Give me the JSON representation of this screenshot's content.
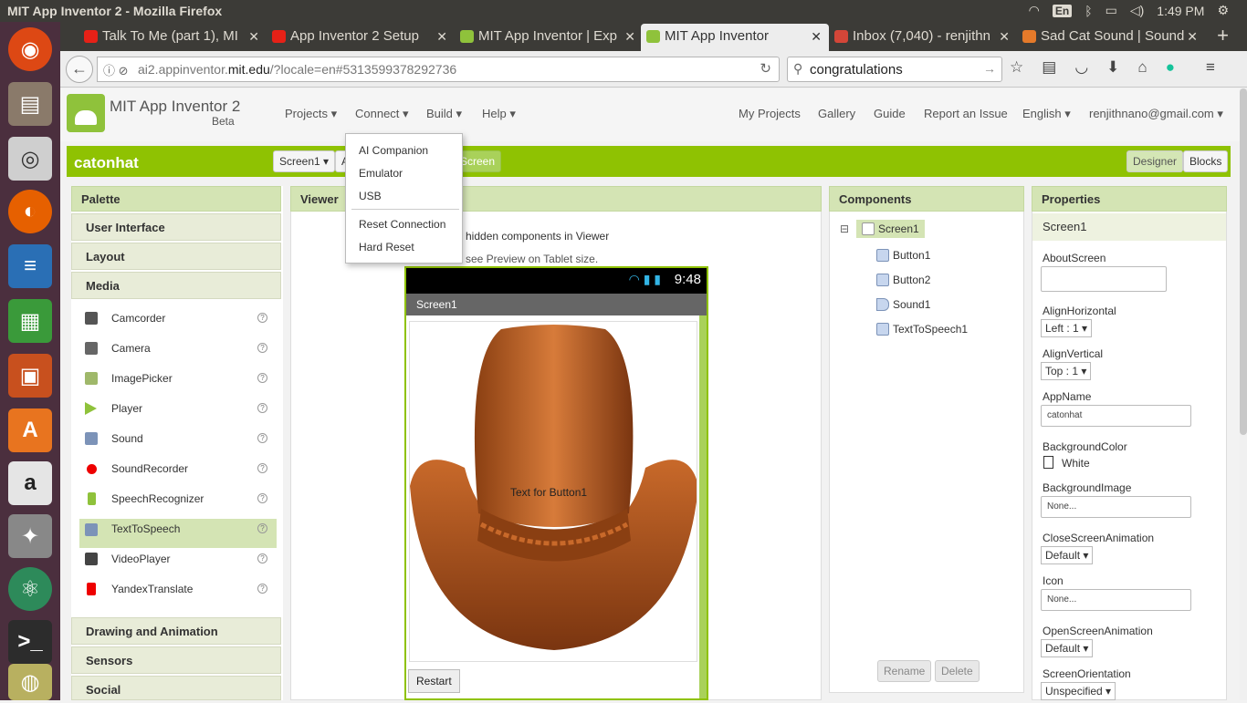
{
  "os": {
    "window_title": "MIT App Inventor 2 - Mozilla Firefox",
    "keyboard": "En",
    "time": "1:49 PM"
  },
  "tabs": [
    {
      "label": "Talk To Me (part 1), MI",
      "color": "#e62117"
    },
    {
      "label": "App Inventor 2 Setup",
      "color": "#e62117"
    },
    {
      "label": "MIT App Inventor | Exp",
      "color": "#8fc23b"
    },
    {
      "label": "MIT App Inventor",
      "color": "#8fc23b"
    },
    {
      "label": "Inbox (7,040) - renjithn",
      "color": "#d44638"
    },
    {
      "label": "Sad Cat Sound | Sound",
      "color": "#e57a2a"
    }
  ],
  "nav": {
    "url_prefix": "ai2.appinventor.",
    "url_domain": "mit.edu",
    "url_suffix": "/?locale=en#5313599378292736",
    "search_value": "congratulations"
  },
  "app": {
    "title": "MIT App Inventor 2",
    "beta": "Beta",
    "menus": {
      "projects": "Projects ▾",
      "connect": "Connect ▾",
      "build": "Build ▾",
      "help": "Help ▾"
    },
    "right_links": {
      "my_projects": "My Projects",
      "gallery": "Gallery",
      "guide": "Guide",
      "report": "Report an Issue",
      "language": "English ▾",
      "account": "renjithnano@gmail.com ▾"
    },
    "accent": "#8fc202"
  },
  "project": {
    "name": "catonhat",
    "screen_select": "Screen1 ▾",
    "add_screen_partial": "A",
    "remove_screen_partial": "Screen",
    "designer": "Designer",
    "blocks": "Blocks"
  },
  "connect_menu": {
    "ai_companion": "AI Companion",
    "emulator": "Emulator",
    "usb": "USB",
    "reset_connection": "Reset Connection",
    "hard_reset": "Hard Reset"
  },
  "palette": {
    "header": "Palette",
    "categories_top": [
      "User Interface",
      "Layout",
      "Media"
    ],
    "items": [
      {
        "label": "Camcorder",
        "icon": "camcorder-icon"
      },
      {
        "label": "Camera",
        "icon": "camera-icon"
      },
      {
        "label": "ImagePicker",
        "icon": "image-picker-icon"
      },
      {
        "label": "Player",
        "icon": "player-icon"
      },
      {
        "label": "Sound",
        "icon": "sound-icon"
      },
      {
        "label": "SoundRecorder",
        "icon": "sound-recorder-icon"
      },
      {
        "label": "SpeechRecognizer",
        "icon": "speech-recognizer-icon"
      },
      {
        "label": "TextToSpeech",
        "icon": "text-to-speech-icon"
      },
      {
        "label": "VideoPlayer",
        "icon": "video-player-icon"
      },
      {
        "label": "YandexTranslate",
        "icon": "yandex-translate-icon"
      }
    ],
    "help_glyph": "?",
    "categories_bottom": [
      "Drawing and Animation",
      "Sensors",
      "Social"
    ]
  },
  "viewer": {
    "header": "Viewer",
    "hidden_text": "hidden components in Viewer",
    "preview_text": "see Preview on Tablet size.",
    "phone_time": "9:48",
    "screen_title": "Screen1",
    "button1_text": "Text for Button1",
    "restart": "Restart"
  },
  "components": {
    "header": "Components",
    "collapse": "⊟",
    "root": "Screen1",
    "children": [
      "Button1",
      "Button2",
      "Sound1",
      "TextToSpeech1"
    ],
    "rename": "Rename",
    "delete": "Delete"
  },
  "properties": {
    "header": "Properties",
    "component": "Screen1",
    "about_screen_label": "AboutScreen",
    "align_h_label": "AlignHorizontal",
    "align_h_value": "Left : 1 ▾",
    "align_v_label": "AlignVertical",
    "align_v_value": "Top : 1 ▾",
    "app_name_label": "AppName",
    "app_name_value": "catonhat",
    "bg_color_label": "BackgroundColor",
    "bg_color_value": "White",
    "bg_image_label": "BackgroundImage",
    "bg_image_value": "None...",
    "close_anim_label": "CloseScreenAnimation",
    "close_anim_value": "Default ▾",
    "icon_label": "Icon",
    "icon_value": "None...",
    "open_anim_label": "OpenScreenAnimation",
    "open_anim_value": "Default ▾",
    "orientation_label": "ScreenOrientation",
    "orientation_value": "Unspecified ▾"
  }
}
